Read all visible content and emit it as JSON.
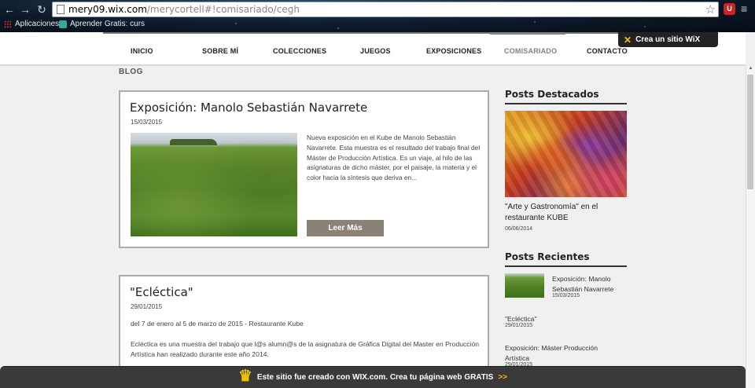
{
  "browser": {
    "url_host": "mery09.wix.com",
    "url_path": "/merycortell#!comisariado/cegh",
    "bookmarks": [
      {
        "label": "Aplicaciones"
      },
      {
        "label": "Aprender Gratis: curs"
      }
    ]
  },
  "site": {
    "menu": [
      {
        "label": "INICIO"
      },
      {
        "label": "SOBRE MÍ"
      },
      {
        "label": "COLECCIONES"
      },
      {
        "label": "JUEGOS"
      },
      {
        "label": "EXPOSICIONES"
      },
      {
        "label": "COMISARIADO"
      },
      {
        "label": "CONTACTO"
      }
    ],
    "active_menu": "COMISARIADO",
    "wix_promo": "Crea un sitio WiX",
    "blog_heading": "BLOG"
  },
  "posts": [
    {
      "title": "Exposición: Manolo Sebastián Navarrete",
      "date": "15/03/2015",
      "excerpt": "Nueva exposición en el Kube de Manolo Sebastián Navarrete. Esta muestra es el resultado del trabajo final del Máster de Producción Artística. Es un viaje, al hilo de las asignaturas de dicho máster, por el paisaje, la materia y el color hacia la síntesis que deriva en...",
      "button": "Leer Más"
    },
    {
      "title": "\"Ecléctica\"",
      "date": "29/01/2015",
      "line1": "del 7 de enero al 5 de marzo de 2015 - Restaurante Kube",
      "line2": "Ecléctica es una muestra del trabajo que l@s alumn@s de la asignatura de Gráfica Digital del Master en Producción Artística han realizado durante este año 2014."
    }
  ],
  "sidebar": {
    "featured_heading": "Posts Destacados",
    "featured": {
      "title": "\"Arte y Gastronomía\" en el restaurante KUBE",
      "date": "06/06/2014"
    },
    "recent_heading": "Posts Recientes",
    "recent": [
      {
        "title": "Exposición: Manolo Sebastián Navarrete",
        "date": "15/03/2015"
      },
      {
        "title": "\"Ecléctica\"",
        "date": "29/01/2015"
      },
      {
        "title": "Exposición: Máster Producción Artística",
        "date": "29/01/2015"
      }
    ]
  },
  "footer_banner": {
    "text": "Este sitio fue creado con WIX.com. Crea tu página web GRATIS",
    "arrows": ">>"
  },
  "colors": {
    "accent": "#8a8177",
    "banner": "#3a3a3a",
    "wix_yellow": "#f0c000"
  }
}
